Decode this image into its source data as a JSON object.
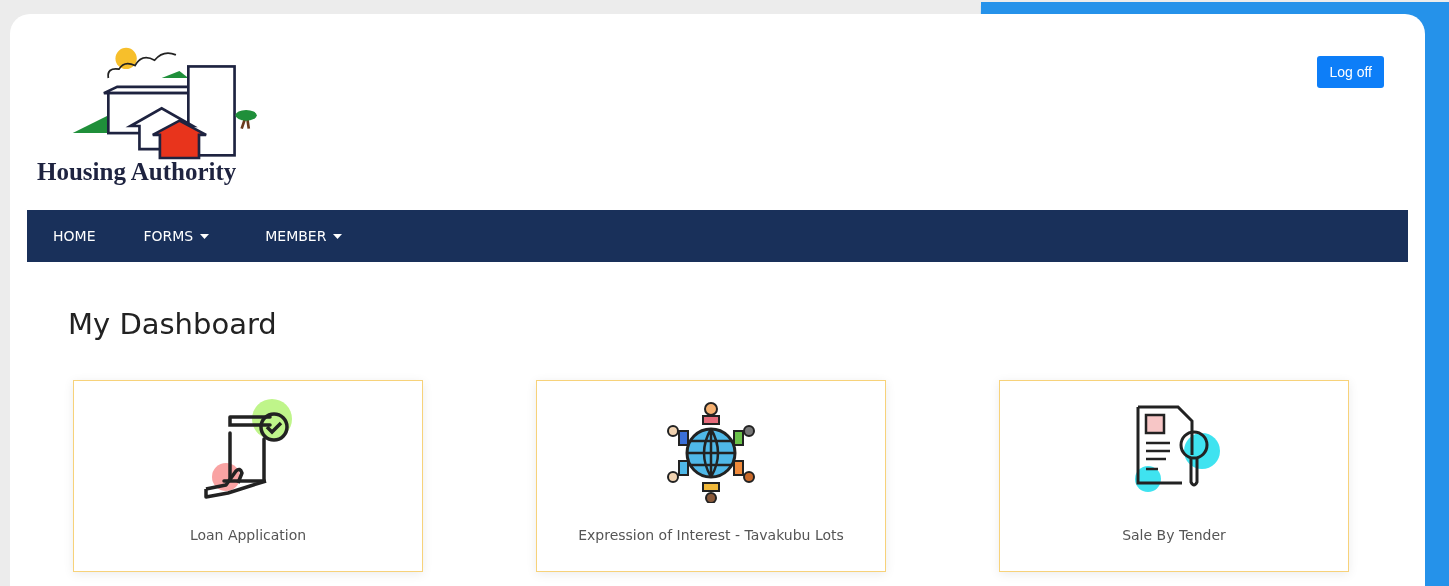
{
  "logo": {
    "text": "Housing Authority"
  },
  "logoff_button": "Log off",
  "nav": [
    {
      "label": "HOME",
      "dropdown": false
    },
    {
      "label": "FORMS",
      "dropdown": true
    },
    {
      "label": "MEMBER",
      "dropdown": true
    }
  ],
  "page_title": "My Dashboard",
  "tiles": [
    {
      "kind": "loan",
      "label": "Loan Application"
    },
    {
      "kind": "interest",
      "label": "Expression of Interest - Tavakubu Lots"
    },
    {
      "kind": "tender",
      "label": "Sale By Tender"
    }
  ]
}
